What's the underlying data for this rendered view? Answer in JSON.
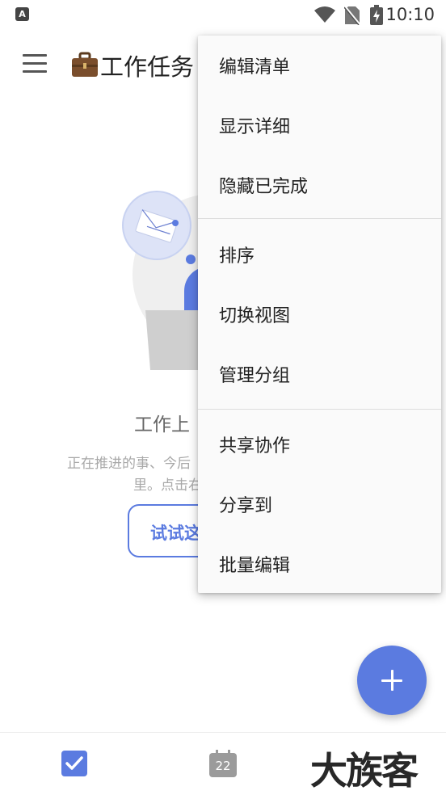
{
  "status_bar": {
    "app_badge": "A",
    "time": "10:10",
    "icons": [
      "wifi-icon",
      "no-sim-icon",
      "battery-charging-icon"
    ]
  },
  "header": {
    "menu_icon": "hamburger-menu-icon",
    "list_icon": "briefcase-icon",
    "title": "工作任务"
  },
  "empty_state": {
    "title": "工作上",
    "description_line1": "正在推进的事、今后",
    "description_line2": "里。点击右",
    "try_button": "试试这"
  },
  "menu": {
    "items": [
      {
        "label": "编辑清单"
      },
      {
        "label": "显示详细"
      },
      {
        "label": "隐藏已完成"
      },
      {
        "label": "排序"
      },
      {
        "label": "切换视图"
      },
      {
        "label": "管理分组"
      },
      {
        "label": "共享协作"
      },
      {
        "label": "分享到"
      },
      {
        "label": "批量编辑"
      }
    ]
  },
  "fab": {
    "icon": "plus-icon"
  },
  "bottom_nav": {
    "tabs": [
      {
        "icon": "checkbox-icon",
        "active": true
      },
      {
        "icon": "calendar-icon",
        "calendar_day": "22"
      }
    ],
    "watermark": "大族客"
  },
  "colors": {
    "accent": "#5b7be0",
    "menu_bg": "#fafafa",
    "muted_text": "#a8a8a8"
  }
}
